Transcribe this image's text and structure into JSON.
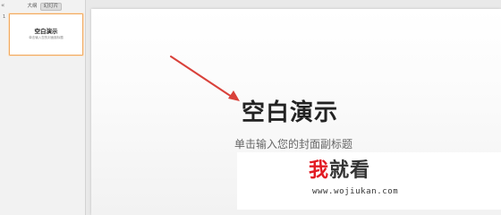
{
  "sidebar": {
    "collapse_glyph": "«",
    "tabs": [
      {
        "label": "大纲"
      },
      {
        "label": "幻灯片",
        "selected": true
      }
    ],
    "slide_number": "1",
    "thumbnail": {
      "title": "空白演示",
      "subtitle": "单击输入您的封面副标题"
    }
  },
  "slide": {
    "title": "空白演示",
    "subtitle": "单击输入您的封面副标题"
  },
  "annotation": {
    "arrow_color": "#d9413a"
  },
  "watermark": {
    "char_1": "我",
    "char_rest": "就看",
    "url": "www.wojiukan.com",
    "accent_color": "#e21b23"
  }
}
